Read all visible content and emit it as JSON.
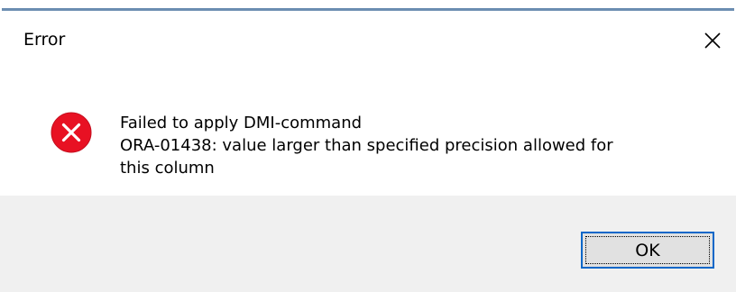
{
  "window": {
    "title": "Error",
    "close_icon": "close-icon"
  },
  "message": {
    "icon": "error-icon",
    "line1": "Failed to apply DMI-command",
    "line2": "ORA-01438: value larger than specified precision allowed for",
    "line3": "this column"
  },
  "buttons": {
    "ok_label": "OK"
  },
  "colors": {
    "error_red": "#e81123",
    "accent_blue": "#0a67c8",
    "footer_bg": "#f0f0f0"
  }
}
